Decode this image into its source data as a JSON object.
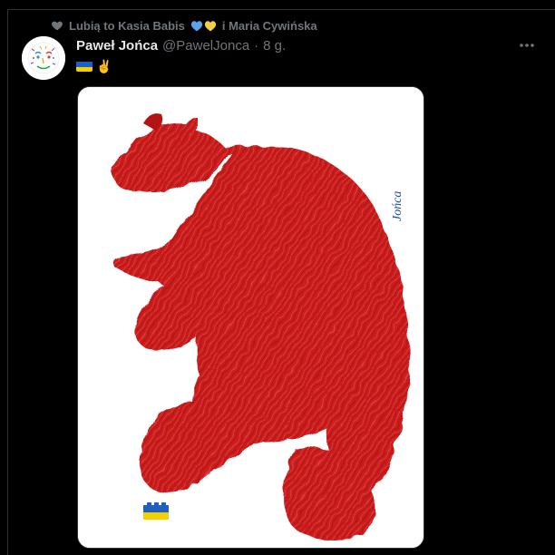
{
  "social_context": {
    "text": "Lubią to Kasia Babis",
    "suffix": "i Maria Cywińska",
    "icon": "heart-icon",
    "hearts": [
      {
        "icon": "blue-heart-icon",
        "color": "#5ba3ec"
      },
      {
        "icon": "yellow-heart-icon",
        "color": "#f7cf46"
      }
    ]
  },
  "tweet": {
    "author": {
      "display_name": "Paweł Jońca",
      "handle": "@PawelJonca",
      "separator": "·",
      "time": "8 g."
    },
    "text": {
      "flag_icon": "ukraine-flag-icon",
      "emoji": "✌"
    },
    "media": {
      "icon": "red-bear-illustration",
      "signature": "Jońca",
      "lego_icon": "lego-brick-icon",
      "bear_color": "#cc1f1f"
    }
  },
  "colors": {
    "background": "#000000",
    "primary_text": "#e7e9ea",
    "secondary_text": "#71767b",
    "border": "#2f3336",
    "ukraine_blue": "#1f5fbf",
    "ukraine_yellow": "#f5d000"
  }
}
